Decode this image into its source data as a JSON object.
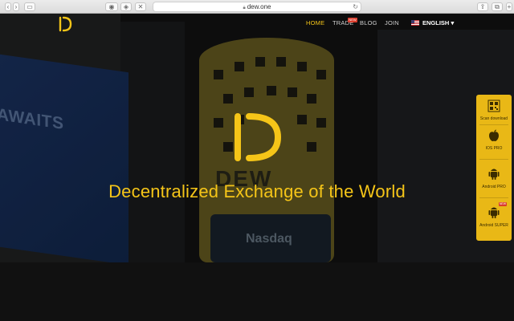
{
  "browser": {
    "url": "dew.one"
  },
  "nav": {
    "items": [
      {
        "label": "HOME"
      },
      {
        "label": "TRADE"
      },
      {
        "label": "BLOG"
      },
      {
        "label": "JOIN"
      }
    ],
    "trade_badge": "NEW",
    "language": "ENGLISH"
  },
  "hero": {
    "tagline": "Decentralized Exchange of the World",
    "billboard_text": "AWAITS",
    "tower_text": "DEW",
    "nasdaq_text": "Nasdaq"
  },
  "download_panel": {
    "scan_label": "Scan download",
    "ios_label": "IOS PRO",
    "android_pro_label": "Android PRO",
    "android_super_label": "Android SUPER",
    "android_super_badge": "NEW"
  },
  "colors": {
    "accent": "#f5c518",
    "panel": "#e9b816",
    "badge": "#d93b2b"
  }
}
